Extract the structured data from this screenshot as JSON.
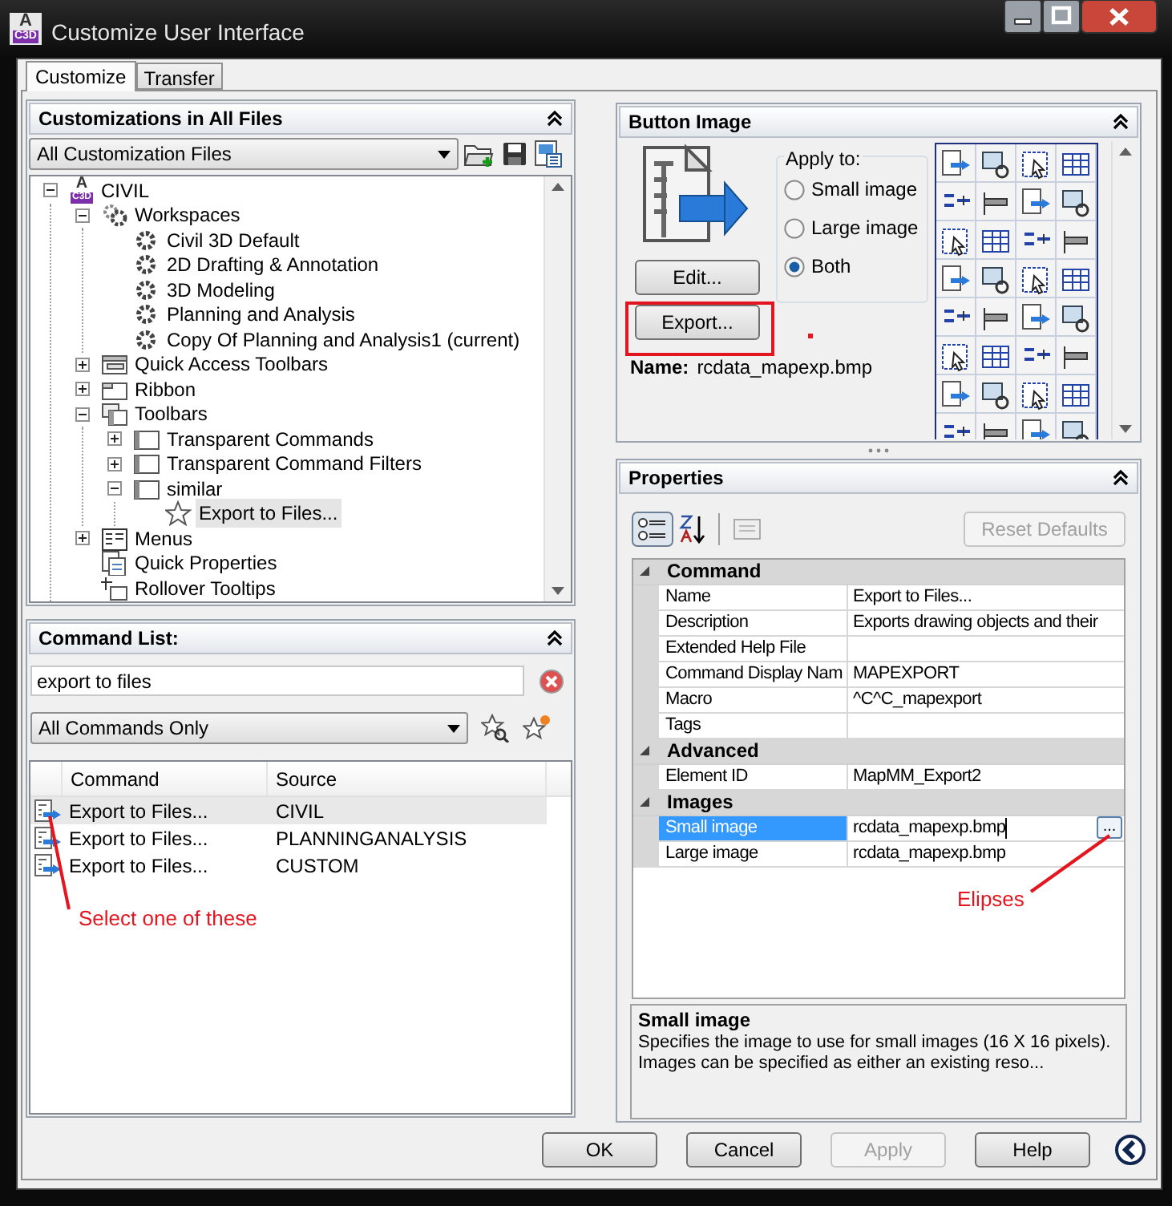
{
  "window": {
    "title": "Customize User Interface",
    "icon_letter": "A",
    "icon_badge": "C3D"
  },
  "tabs": [
    {
      "label": "Customize",
      "selected": true
    },
    {
      "label": "Transfer",
      "selected": false
    }
  ],
  "customizations_panel": {
    "title": "Customizations in All Files",
    "filter": "All Customization Files",
    "tree": [
      {
        "label": "CIVIL",
        "kind": "file",
        "icon_letter": "A",
        "icon_badge": "C3D",
        "expanded": true,
        "selected": false,
        "children": [
          {
            "label": "Workspaces",
            "kind": "workspaces",
            "expanded": true,
            "selected": false,
            "children": [
              {
                "label": "Civil 3D Default",
                "kind": "workspace",
                "selected": false
              },
              {
                "label": "2D Drafting & Annotation",
                "kind": "workspace",
                "selected": false
              },
              {
                "label": "3D Modeling",
                "kind": "workspace",
                "selected": false
              },
              {
                "label": "Planning and Analysis",
                "kind": "workspace",
                "selected": false
              },
              {
                "label": "Copy Of Planning and Analysis1 (current)",
                "kind": "workspace",
                "selected": false
              }
            ]
          },
          {
            "label": "Quick Access Toolbars",
            "kind": "quick_access",
            "expanded": false,
            "selected": false
          },
          {
            "label": "Ribbon",
            "kind": "ribbon",
            "expanded": false,
            "selected": false
          },
          {
            "label": "Toolbars",
            "kind": "toolbars",
            "expanded": true,
            "selected": false,
            "children": [
              {
                "label": "Transparent Commands",
                "kind": "toolbar",
                "expanded": false,
                "selected": false
              },
              {
                "label": "Transparent Command Filters",
                "kind": "toolbar",
                "expanded": false,
                "selected": false
              },
              {
                "label": "similar",
                "kind": "toolbar",
                "expanded": true,
                "selected": false,
                "children": [
                  {
                    "label": "Export to Files...",
                    "kind": "command",
                    "selected": true
                  }
                ]
              }
            ]
          },
          {
            "label": "Menus",
            "kind": "menus",
            "expanded": false,
            "selected": false
          },
          {
            "label": "Quick Properties",
            "kind": "properties",
            "selected": false
          },
          {
            "label": "Rollover Tooltips",
            "kind": "tooltips",
            "selected": false
          }
        ]
      }
    ]
  },
  "command_list_panel": {
    "title": "Command List:",
    "search": "export to files",
    "filter": "All Commands Only",
    "columns": [
      "Command",
      "Source"
    ],
    "rows": [
      {
        "command": "Export to Files...",
        "source": "CIVIL",
        "selected": true
      },
      {
        "command": "Export to Files...",
        "source": "PLANNINGANALYSIS",
        "selected": false
      },
      {
        "command": "Export to Files...",
        "source": "CUSTOM",
        "selected": false
      }
    ]
  },
  "button_image_panel": {
    "title": "Button Image",
    "apply_to_label": "Apply to:",
    "options": [
      {
        "label": "Small image",
        "selected": false
      },
      {
        "label": "Large image",
        "selected": false
      },
      {
        "label": "Both",
        "selected": true
      }
    ],
    "buttons": [
      "Edit...",
      "Export..."
    ],
    "name_label": "Name:",
    "name_value": "rcdata_mapexp.bmp"
  },
  "properties_panel": {
    "title": "Properties",
    "reset_button": {
      "label": "Reset Defaults",
      "disabled": true
    },
    "categories": [
      {
        "name": "Command",
        "expanded": true,
        "rows": [
          {
            "name": "Name",
            "value": "Export to Files...",
            "selected": false
          },
          {
            "name": "Description",
            "value": "Exports drawing objects and their",
            "selected": false
          },
          {
            "name": "Extended Help File",
            "selected": false
          },
          {
            "name": "Command Display Nam",
            "value": "MAPEXPORT",
            "selected": false
          },
          {
            "name": "Macro",
            "value": "^C^C_mapexport",
            "selected": false
          },
          {
            "name": "Tags",
            "selected": false
          }
        ]
      },
      {
        "name": "Advanced",
        "expanded": true,
        "rows": [
          {
            "name": "Element ID",
            "value": "MapMM_Export2",
            "selected": false
          }
        ]
      },
      {
        "name": "Images",
        "expanded": true,
        "rows": [
          {
            "name": "Small image",
            "value": "rcdata_mapexp.bmp",
            "selected": true,
            "editing": true,
            "button_label": "..."
          },
          {
            "name": "Large image",
            "value": "rcdata_mapexp.bmp",
            "selected": false
          }
        ]
      }
    ],
    "description": {
      "title": "Small image",
      "text": "Specifies the image to use for small images (16 X 16 pixels). Images can be specified as either an existing reso..."
    }
  },
  "footer_buttons": [
    {
      "label": "OK",
      "disabled": false
    },
    {
      "label": "Cancel",
      "disabled": false
    },
    {
      "label": "Apply",
      "disabled": true
    },
    {
      "label": "Help",
      "disabled": false
    }
  ],
  "annotations": [
    {
      "kind": "box"
    },
    {
      "kind": "dot"
    },
    {
      "kind": "arrow",
      "text": "Select one of these"
    },
    {
      "kind": "arrow",
      "text": "Elipses"
    }
  ]
}
